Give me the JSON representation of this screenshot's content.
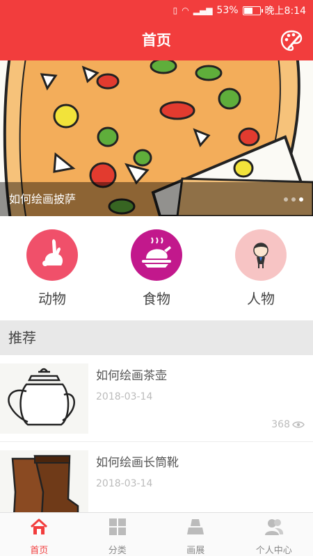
{
  "status_bar": {
    "battery": "53%",
    "time": "晚上8:14",
    "icons": [
      "vibrate-icon",
      "wifi-icon",
      "signal-icon",
      "battery-icon"
    ]
  },
  "header": {
    "title": "首页",
    "right_icon": "palette-icon"
  },
  "banner": {
    "caption": "如何绘画披萨",
    "page_count": 3,
    "active_page": 3
  },
  "categories": [
    {
      "label": "动物",
      "icon": "rabbit-icon",
      "color": "#f0506a"
    },
    {
      "label": "食物",
      "icon": "roast-chicken-icon",
      "color": "#c2188c"
    },
    {
      "label": "人物",
      "icon": "person-icon",
      "color": "#f7c4c4"
    }
  ],
  "recommend": {
    "title": "推荐",
    "items": [
      {
        "title": "如何绘画茶壶",
        "date": "2018-03-14",
        "views": "368",
        "thumb": "teapot-image"
      },
      {
        "title": "如何绘画长筒靴",
        "date": "2018-03-14",
        "views": "",
        "thumb": "boots-image"
      }
    ]
  },
  "tabs": [
    {
      "label": "首页",
      "icon": "home-icon",
      "active": true
    },
    {
      "label": "分类",
      "icon": "grid-icon",
      "active": false
    },
    {
      "label": "画展",
      "icon": "exhibition-icon",
      "active": false
    },
    {
      "label": "个人中心",
      "icon": "user-icon",
      "active": false
    }
  ],
  "colors": {
    "primary": "#f23d3d",
    "muted": "#bbbbbb"
  }
}
